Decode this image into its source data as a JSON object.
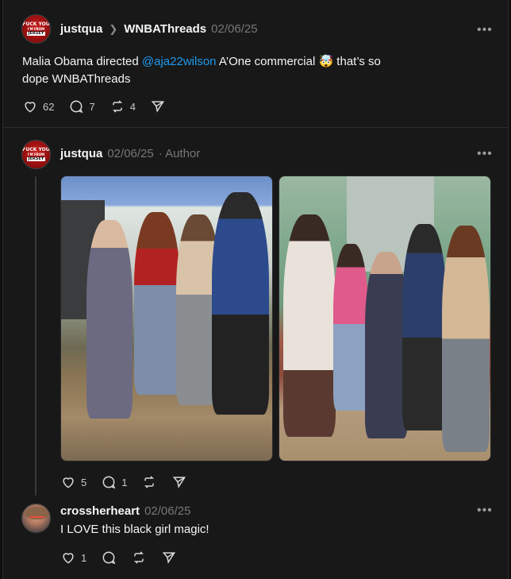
{
  "post": {
    "username": "justqua",
    "community": "WNBAThreads",
    "date": "02/06/25",
    "text_before": "Malia Obama directed ",
    "mention": "@aja22wilson",
    "text_after": " A’One commercial 🤯 that’s so dope WNBAThreads",
    "likes": "62",
    "replies": "7",
    "reposts": "4",
    "more_label": "•••"
  },
  "reply1": {
    "username": "justqua",
    "date": "02/06/25",
    "author_tag": "· Author",
    "likes": "5",
    "replies": "1",
    "more_label": "•••"
  },
  "reply2": {
    "username": "crossherheart",
    "date": "02/06/25",
    "text": "I LOVE this black girl magic!",
    "likes": "1",
    "more_label": "•••"
  },
  "avatar_logo": {
    "line1": "FUCK YOU",
    "line2": "I'M FROM",
    "line3": "JERSEY"
  },
  "colors": {
    "background": "#181818",
    "mention": "#1d9bf0",
    "muted": "#777777"
  }
}
